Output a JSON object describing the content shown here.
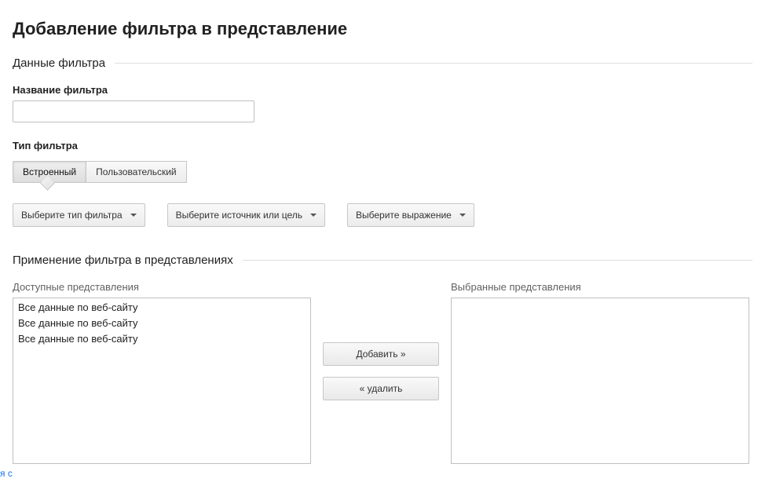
{
  "page_title": "Добавление фильтра в представление",
  "section_filter_data": "Данные фильтра",
  "filter_name_label": "Название фильтра",
  "filter_name_value": "",
  "filter_type_label": "Тип фильтра",
  "segmented": {
    "builtin_label": "Встроенный",
    "custom_label": "Пользовательский",
    "active": "builtin"
  },
  "dropdowns": {
    "filter_type": "Выберите тип фильтра",
    "source_target": "Выберите источник или цель",
    "expression": "Выберите выражение"
  },
  "section_apply": "Применение фильтра в представлениях",
  "available_label": "Доступные представления",
  "selected_label": "Выбранные представления",
  "available_views": [
    "Все данные по веб-сайту",
    "Все данные по веб-сайту",
    "Все данные по веб-сайту"
  ],
  "selected_views": [],
  "buttons": {
    "add": "Добавить »",
    "remove": "« удалить"
  },
  "corner_link": "я с"
}
